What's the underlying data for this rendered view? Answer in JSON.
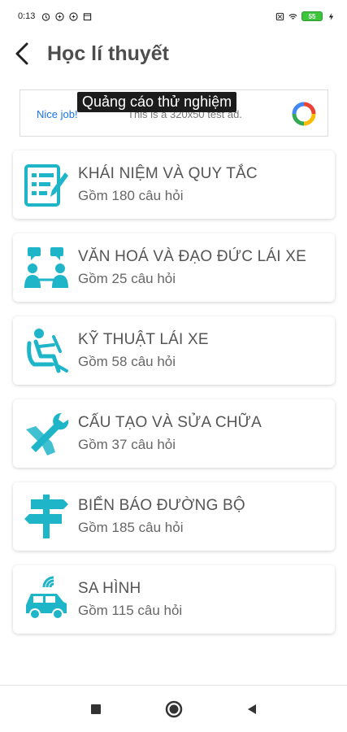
{
  "status_bar": {
    "time": "0:13",
    "battery": "55"
  },
  "header": {
    "title": "Học lí thuyết"
  },
  "ad": {
    "label": "Quảng cáo thử nghiệm",
    "nice_job": "Nice job!",
    "subtext": "This is a 320x50 test ad."
  },
  "categories": [
    {
      "title": "KHÁI NIỆM VÀ QUY TẮC",
      "count": "Gồm 180 câu hỏi",
      "icon": "document-pen-icon"
    },
    {
      "title": "VĂN HOÁ VÀ ĐẠO ĐỨC LÁI XE",
      "count": "Gồm 25 câu hỏi",
      "icon": "people-chat-icon"
    },
    {
      "title": "KỸ THUẬT LÁI XE",
      "count": "Gồm 58 câu hỏi",
      "icon": "driver-seat-icon"
    },
    {
      "title": "CẤU TẠO VÀ SỬA CHỮA",
      "count": "Gồm 37 câu hỏi",
      "icon": "wrench-screwdriver-icon"
    },
    {
      "title": "BIỂN BÁO ĐƯỜNG BỘ",
      "count": "Gồm 185 câu hỏi",
      "icon": "road-sign-icon"
    },
    {
      "title": "SA HÌNH",
      "count": "Gồm 115 câu hỏi",
      "icon": "car-signal-icon"
    }
  ],
  "colors": {
    "accent": "#1fb5c9",
    "title_text": "#4d4d4d"
  }
}
